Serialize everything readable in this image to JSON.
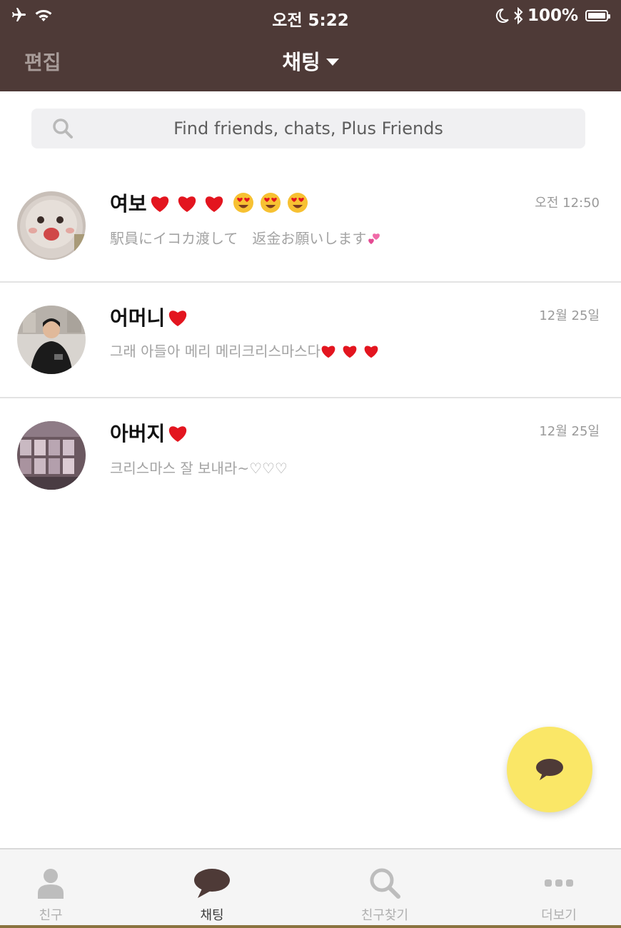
{
  "status_bar": {
    "time": "오전 5:22",
    "battery": "100%",
    "icons": [
      "airplane-icon",
      "wifi-icon",
      "moon-icon",
      "bluetooth-icon",
      "battery-icon"
    ]
  },
  "nav": {
    "edit_label": "편집",
    "title": "채팅"
  },
  "search": {
    "placeholder": "Find friends, chats, Plus Friends"
  },
  "chats": [
    {
      "name": "여보",
      "preview": "駅員にイコカ渡して　返金お願いします",
      "time": "오전 12:50"
    },
    {
      "name": "어머니",
      "preview": "그래 아들아 메리 메리크리스마스다",
      "time": "12월 25일"
    },
    {
      "name": "아버지",
      "preview": "크리스마스 잘 보내라~♡♡♡",
      "time": "12월 25일"
    }
  ],
  "tabs": [
    {
      "label": "친구",
      "icon": "person-icon"
    },
    {
      "label": "채팅",
      "icon": "chat-bubble-icon"
    },
    {
      "label": "친구찾기",
      "icon": "search-icon"
    },
    {
      "label": "더보기",
      "icon": "more-icon"
    }
  ],
  "colors": {
    "header": "#4e3a37",
    "fab": "#fae767",
    "heart": "#e3151f"
  }
}
